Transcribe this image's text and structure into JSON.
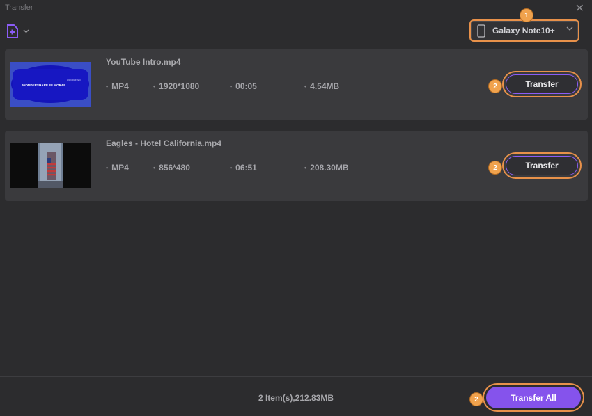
{
  "window": {
    "title": "Transfer"
  },
  "toolbar": {
    "add_icon": "add-file-icon",
    "device_name": "Galaxy Note10+"
  },
  "annotations": {
    "step1": "1",
    "step2": "2"
  },
  "files": [
    {
      "name": "YouTube Intro.mp4",
      "format": "MP4",
      "resolution": "1920*1080",
      "duration": "00:05",
      "size": "4.54MB",
      "thumb_subtitle": "WONDERSHARE FILMORA9",
      "thumb_tagline": "WIZCRAFTED",
      "button": "Transfer"
    },
    {
      "name": "Eagles - Hotel California.mp4",
      "format": "MP4",
      "resolution": "856*480",
      "duration": "06:51",
      "size": "208.30MB",
      "button": "Transfer"
    }
  ],
  "footer": {
    "summary": "2 Item(s),212.83MB",
    "transfer_all": "Transfer All"
  },
  "colors": {
    "accent": "#8553ec",
    "highlight": "#e8914a",
    "badge": "#f0a24d"
  }
}
